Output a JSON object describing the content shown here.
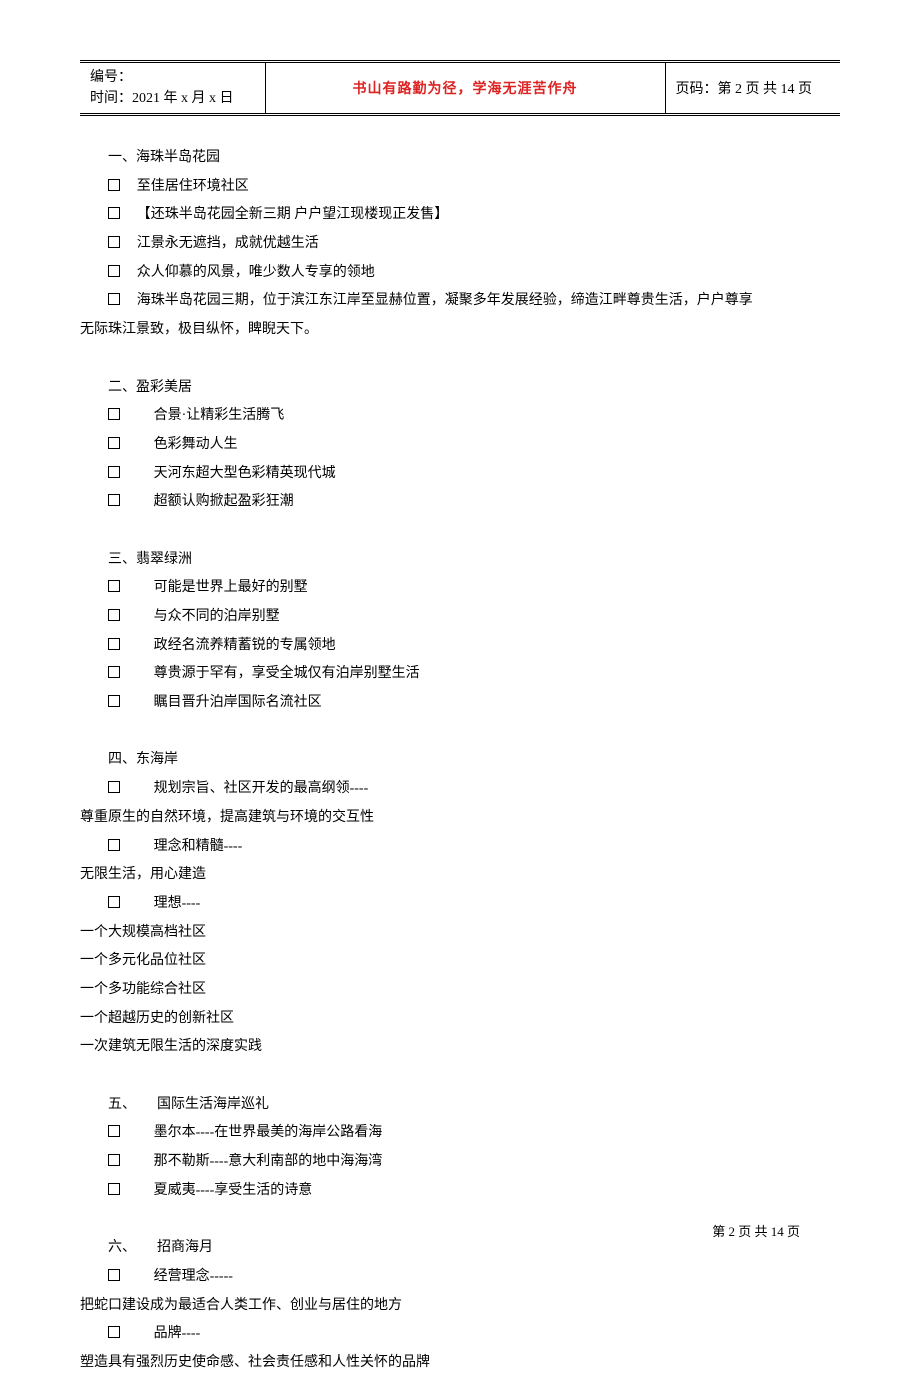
{
  "header": {
    "left_line1": "编号：",
    "left_line2": "时间：2021 年 x 月 x 日",
    "motto": "书山有路勤为径，学海无涯苦作舟",
    "right": "页码：第 2 页 共 14 页"
  },
  "sections": [
    {
      "title": "一、海珠半岛花园",
      "items": [
        "至佳居住环境社区",
        "【还珠半岛花园全新三期 户户望江现楼现正发售】",
        "江景永无遮挡，成就优越生活",
        "众人仰慕的风景，唯少数人专享的领地",
        "海珠半岛花园三期，位于滨江东江岸至显赫位置，凝聚多年发展经验，缔造江畔尊贵生活，户户尊享"
      ],
      "wrap": "无际珠江景致，极目纵怀，睥睨天下。"
    },
    {
      "title": "二、盈彩美居",
      "items": [
        "合景·让精彩生活腾飞",
        "色彩舞动人生",
        "天河东超大型色彩精英现代城",
        "超额认购掀起盈彩狂潮"
      ]
    },
    {
      "title": "三、翡翠绿洲",
      "items": [
        "可能是世界上最好的别墅",
        "与众不同的泊岸别墅",
        "政经名流养精蓄锐的专属领地",
        "尊贵源于罕有，享受全城仅有泊岸别墅生活",
        "瞩目晋升泊岸国际名流社区"
      ]
    },
    {
      "title": "四、东海岸",
      "blocks": [
        {
          "box": true,
          "text": "规划宗旨、社区开发的最高纲领----"
        },
        {
          "box": false,
          "text": "尊重原生的自然环境，提高建筑与环境的交互性"
        },
        {
          "box": true,
          "text": "理念和精髓----"
        },
        {
          "box": false,
          "text": "无限生活，用心建造"
        },
        {
          "box": true,
          "text": "理想----"
        },
        {
          "box": false,
          "text": "一个大规模高档社区"
        },
        {
          "box": false,
          "text": "一个多元化品位社区"
        },
        {
          "box": false,
          "text": "一个多功能综合社区"
        },
        {
          "box": false,
          "text": "一个超越历史的创新社区"
        },
        {
          "box": false,
          "text": "一次建筑无限生活的深度实践"
        }
      ]
    },
    {
      "title": "五、　　国际生活海岸巡礼",
      "items": [
        "墨尔本----在世界最美的海岸公路看海",
        "那不勒斯----意大利南部的地中海海湾",
        "夏威夷----享受生活的诗意"
      ]
    },
    {
      "title": "六、　　招商海月",
      "blocks": [
        {
          "box": true,
          "text": "经营理念-----"
        },
        {
          "box": false,
          "text": "把蛇口建设成为最适合人类工作、创业与居住的地方"
        },
        {
          "box": true,
          "text": "品牌----"
        },
        {
          "box": false,
          "text": "塑造具有强烈历史使命感、社会责任感和人性关怀的品牌"
        }
      ]
    }
  ],
  "footer": "第 2 页 共 14 页"
}
